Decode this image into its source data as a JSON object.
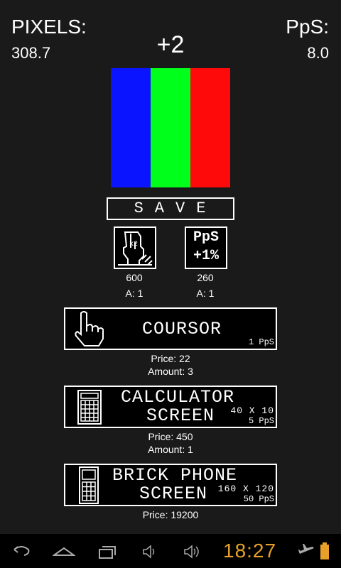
{
  "header": {
    "pixels_label": "PIXELS:",
    "pixels_value": "308.7",
    "pps_label": "PpS:",
    "pps_value": "8.0",
    "click_gain": "+2"
  },
  "pixel": {
    "colors": [
      "#0a14ff",
      "#00ff1a",
      "#ff0a0a"
    ]
  },
  "save": {
    "label": "SAVE"
  },
  "upgrades": [
    {
      "icon": "double-click-hand-icon",
      "badge": "x2",
      "price": "600",
      "amount": "A: 1"
    },
    {
      "icon": "pps-percent-icon",
      "line1": "PpS",
      "line2": "+1%",
      "price": "260",
      "amount": "A: 1"
    }
  ],
  "shop": [
    {
      "icon": "cursor-hand-icon",
      "name_line1": "COURSOR",
      "pps": "1 PpS",
      "price": "Price: 22",
      "amount": "Amount: 3"
    },
    {
      "icon": "calculator-icon",
      "name_line1": "CALCULATOR",
      "name_line2": "SCREEN",
      "resolution": "40 X 10",
      "pps": "5 PpS",
      "price": "Price: 450",
      "amount": "Amount: 1"
    },
    {
      "icon": "brick-phone-icon",
      "name_line1": "BRICK PHONE",
      "name_line2": "SCREEN",
      "resolution": "160 X 120",
      "pps": "50 PpS",
      "price": "Price: 19200"
    }
  ],
  "status": {
    "clock": "18:27",
    "accent": "#e8a02a",
    "icons": [
      "back-icon",
      "home-icon",
      "recent-apps-icon",
      "volume-down-icon",
      "volume-up-icon",
      "airplane-icon",
      "battery-icon"
    ]
  }
}
